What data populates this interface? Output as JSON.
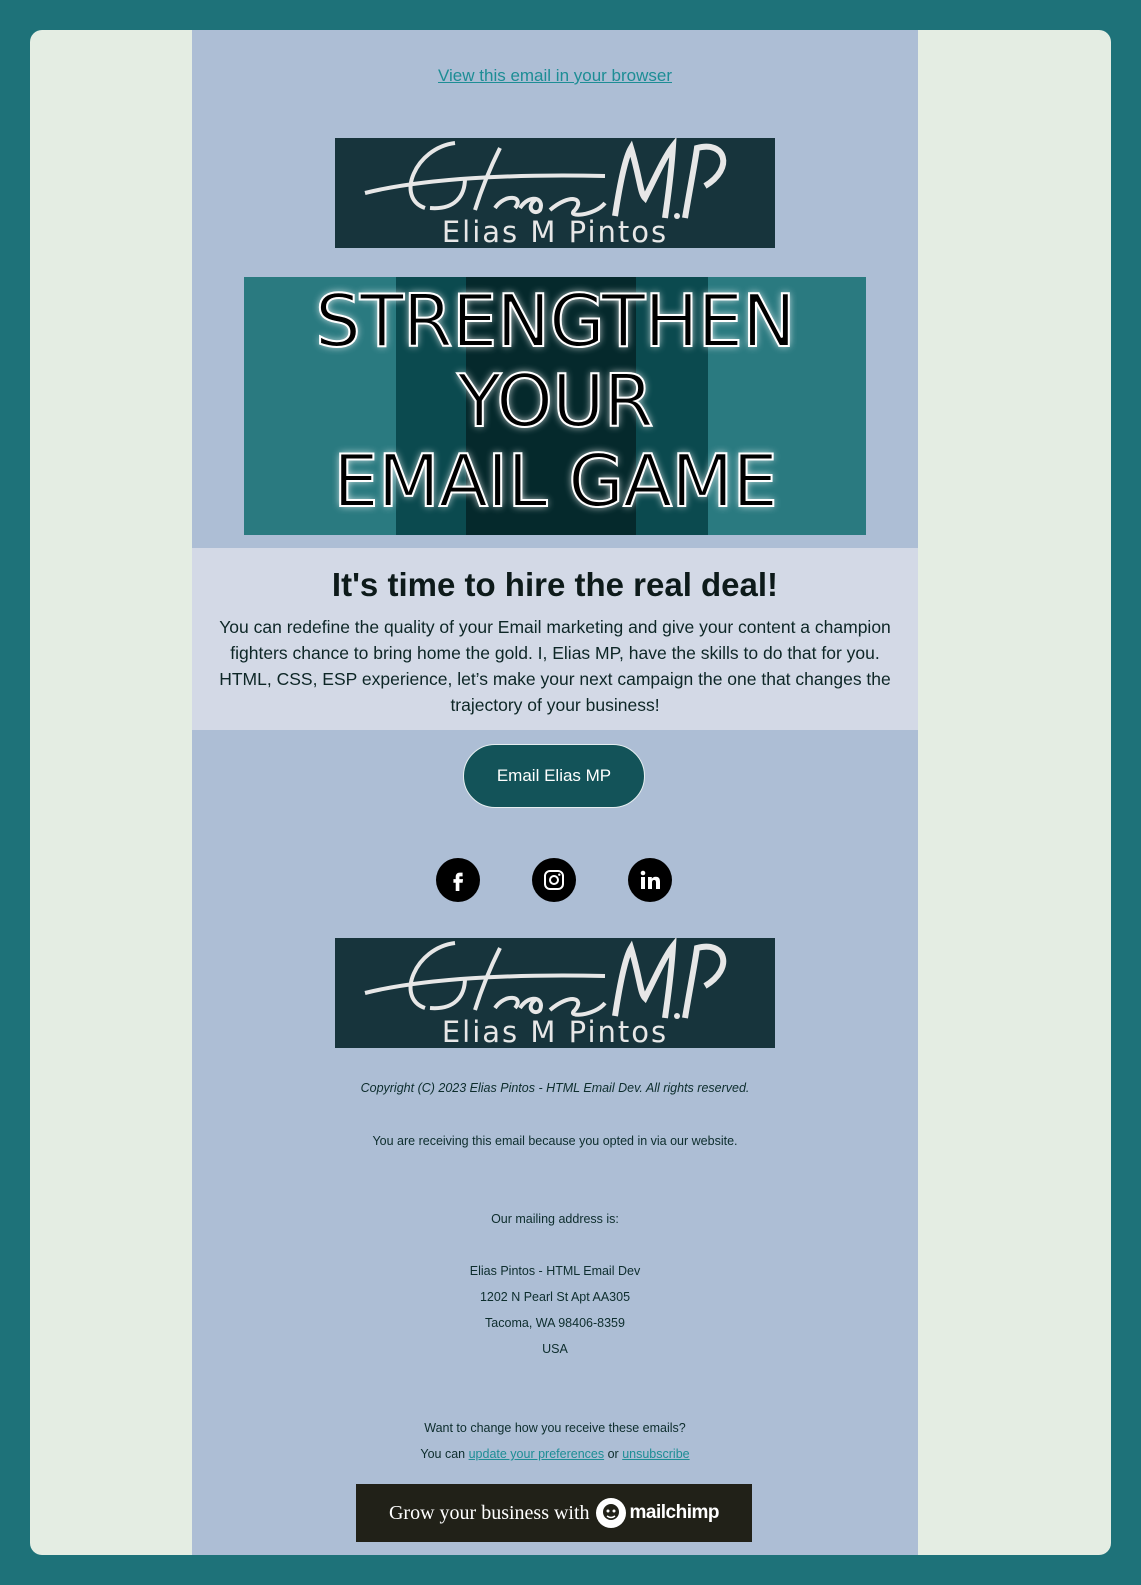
{
  "colors": {
    "outer_bg": "#1e7279",
    "frame_bg": "#e4ede3",
    "email_bg": "#adbed5",
    "content_bg": "#d3d9e6",
    "logo_bg": "#17343c",
    "cta_bg": "#135359",
    "link": "#1d8d95"
  },
  "header": {
    "browser_link": "View this email in your browser"
  },
  "logo": {
    "name": "Elias M Pintos",
    "signature": "Elias MP"
  },
  "hero": {
    "line1": "STRENGTHEN",
    "line2": "YOUR",
    "line3": "EMAIL GAME"
  },
  "content": {
    "headline": "It's time to hire the real deal!",
    "body": "You can redefine the quality of your Email marketing and give your content a champion fighters chance to bring home the gold. I, Elias MP, have the skills to do that for you. HTML, CSS, ESP experience, let’s make your next campaign the one that changes the trajectory of your business!"
  },
  "cta": {
    "label": "Email Elias MP"
  },
  "social": {
    "icons": [
      "facebook-icon",
      "instagram-icon",
      "linkedin-icon"
    ]
  },
  "footer": {
    "copyright": "Copyright (C) 2023 Elias Pintos - HTML Email Dev. All rights reserved.",
    "opt_in": "You are receiving this email because you opted in via our website.",
    "address_label": "Our mailing address is:",
    "address_line1": "Elias Pintos - HTML Email Dev",
    "address_line2": "1202 N Pearl St Apt AA305",
    "address_line3": "Tacoma, WA 98406-8359",
    "address_line4": "USA",
    "change_prompt": "Want to change how you receive these emails?",
    "you_can": "You can",
    "update_link": "update your preferences",
    "or": "or",
    "unsubscribe_link": "unsubscribe"
  },
  "mailchimp": {
    "text": "Grow your business with",
    "brand": "mailchimp"
  }
}
